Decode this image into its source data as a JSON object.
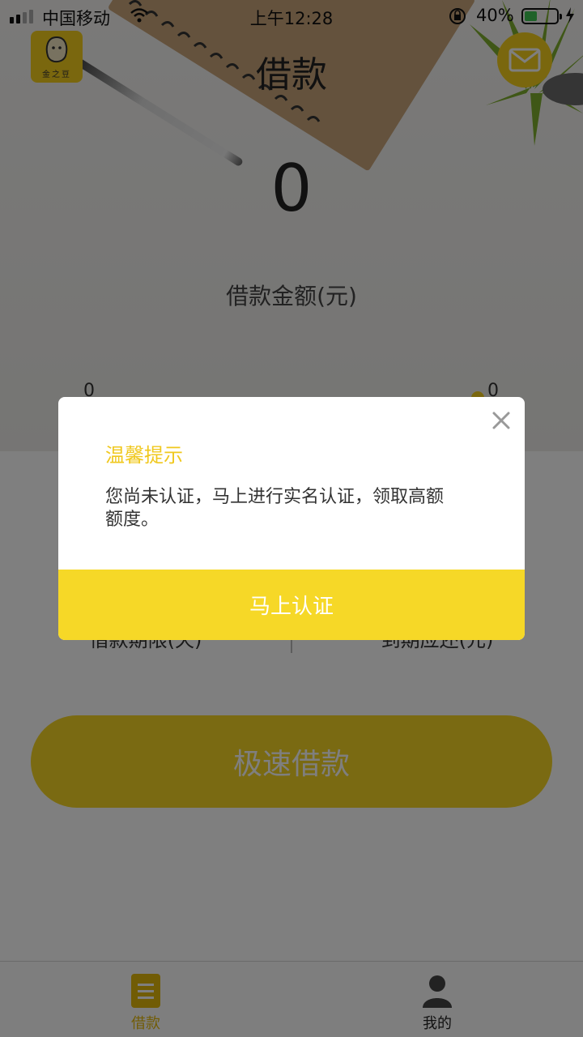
{
  "status_bar": {
    "carrier": "中国移动",
    "time": "上午12:28",
    "battery_percent": "40%",
    "battery_level": 0.4
  },
  "header": {
    "logo_text": "金之豆",
    "title": "借款"
  },
  "loan": {
    "amount": "0",
    "amount_label": "借款金额(元)",
    "slider_min": "0",
    "slider_max": "0",
    "term_label": "借款期限(天)",
    "due_label": "到期应还(元)",
    "submit_label": "极速借款"
  },
  "tab_bar": {
    "items": [
      {
        "label": "借款",
        "active": true
      },
      {
        "label": "我的",
        "active": false
      }
    ]
  },
  "dialog": {
    "title": "温馨提示",
    "message": "您尚未认证，马上进行实名认证，领取高额额度。",
    "action_label": "马上认证"
  },
  "colors": {
    "accent": "#f5cf1d",
    "dialog_title": "#f0c81e",
    "overlay": "rgba(0,0,0,0.5)"
  },
  "icons": [
    "signal-icon",
    "wifi-icon",
    "orientation-lock-icon",
    "battery-icon",
    "charging-icon",
    "mail-icon",
    "close-icon",
    "list-icon",
    "user-icon"
  ]
}
